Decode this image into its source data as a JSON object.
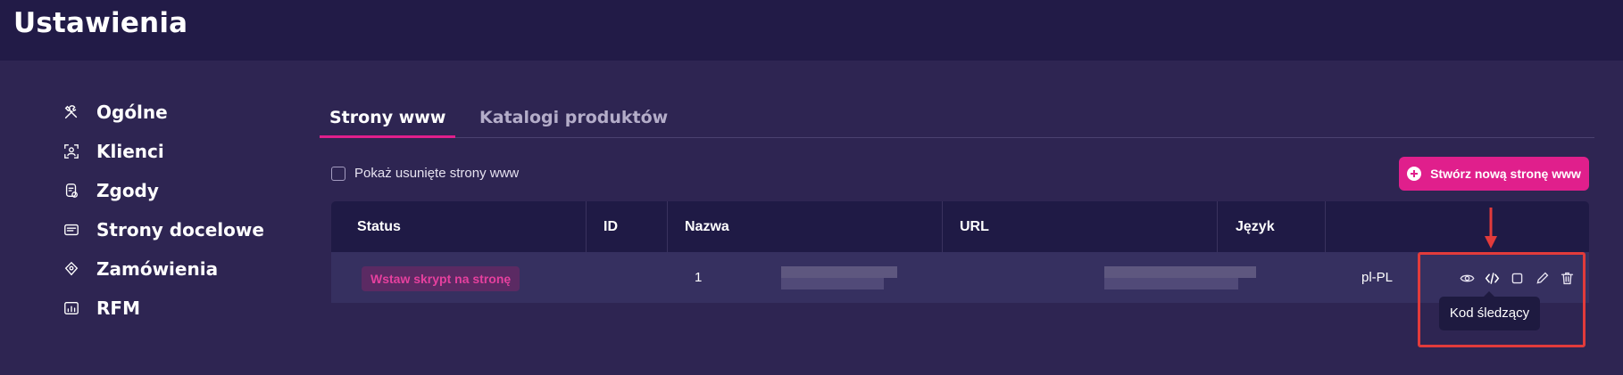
{
  "header": {
    "title": "Ustawienia"
  },
  "sidebar": {
    "items": [
      {
        "label": "Ogólne",
        "icon": "tools-icon"
      },
      {
        "label": "Klienci",
        "icon": "user-frame-icon"
      },
      {
        "label": "Zgody",
        "icon": "consent-icon"
      },
      {
        "label": "Strony docelowe",
        "icon": "landing-page-icon"
      },
      {
        "label": "Zamówienia",
        "icon": "orders-icon"
      },
      {
        "label": "RFM",
        "icon": "rfm-chart-icon"
      }
    ]
  },
  "tabs": [
    {
      "label": "Strony www",
      "active": true
    },
    {
      "label": "Katalogi produktów",
      "active": false
    }
  ],
  "filters": {
    "show_deleted_label": "Pokaż usunięte strony www",
    "show_deleted_checked": false
  },
  "toolbar": {
    "create_label": "Stwórz nową stronę www"
  },
  "table": {
    "columns": [
      "Status",
      "ID",
      "Nazwa",
      "URL",
      "Język"
    ],
    "rows": [
      {
        "status": "Wstaw skrypt na stronę",
        "id": "1",
        "name": "",
        "url": "",
        "language": "pl-PL"
      }
    ],
    "row_actions": [
      "eye-icon",
      "code-icon",
      "square-icon",
      "pencil-icon",
      "trash-icon"
    ]
  },
  "tooltip": {
    "text": "Kod śledzący"
  },
  "colors": {
    "accent": "#e01f8c",
    "background": "#2e2552",
    "header_bg": "#221b47",
    "annotation": "#e23b3b"
  }
}
